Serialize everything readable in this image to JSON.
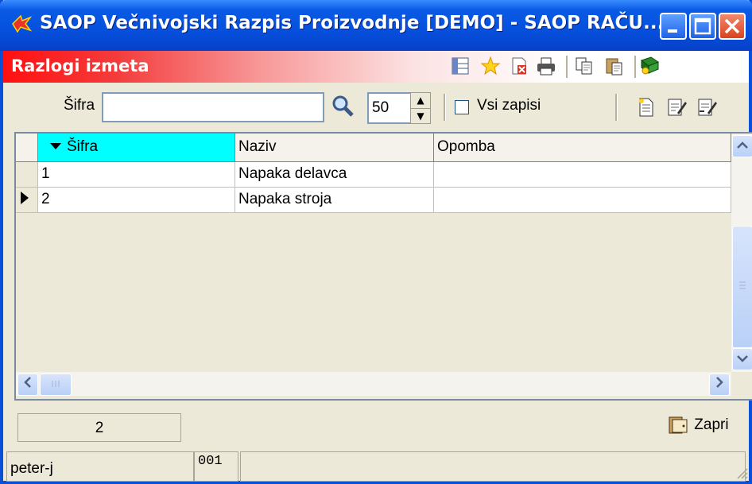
{
  "window": {
    "title": "SAOP Večnivojski Razpis Proizvodnje [DEMO] - SAOP RAČU...",
    "buttons": [
      "minimize",
      "maximize",
      "close"
    ]
  },
  "band": {
    "title": "Razlogi izmeta",
    "toolbar_icons": [
      "columns-icon",
      "star-icon",
      "delete-icon",
      "print-icon",
      "copy-icon",
      "paste-icon",
      "help-book-icon"
    ]
  },
  "filter": {
    "sifra_label": "Šifra",
    "sifra_value": "",
    "count_value": "50",
    "all_records_label": "Vsi zapisi",
    "all_records_checked": false,
    "action_icons": [
      "new-record-icon",
      "edit-record-icon",
      "edit-copy-icon"
    ]
  },
  "table": {
    "columns": [
      "Šifra",
      "Naziv",
      "Opomba"
    ],
    "rows": [
      {
        "sifra": "1",
        "naziv": "Napaka delavca",
        "opomba": ""
      },
      {
        "sifra": "2",
        "naziv": "Napaka stroja",
        "opomba": ""
      }
    ],
    "current_row": 1,
    "sorted_column": "Šifra"
  },
  "footer": {
    "record_count": "2",
    "close_label": "Zapri"
  },
  "statusbar": {
    "user": "peter-j",
    "code": "001",
    "extra": ""
  },
  "colors": {
    "title_blue": "#0a5ae4",
    "band_red": "#ff1010",
    "sort_header_cyan": "#00ffff"
  }
}
